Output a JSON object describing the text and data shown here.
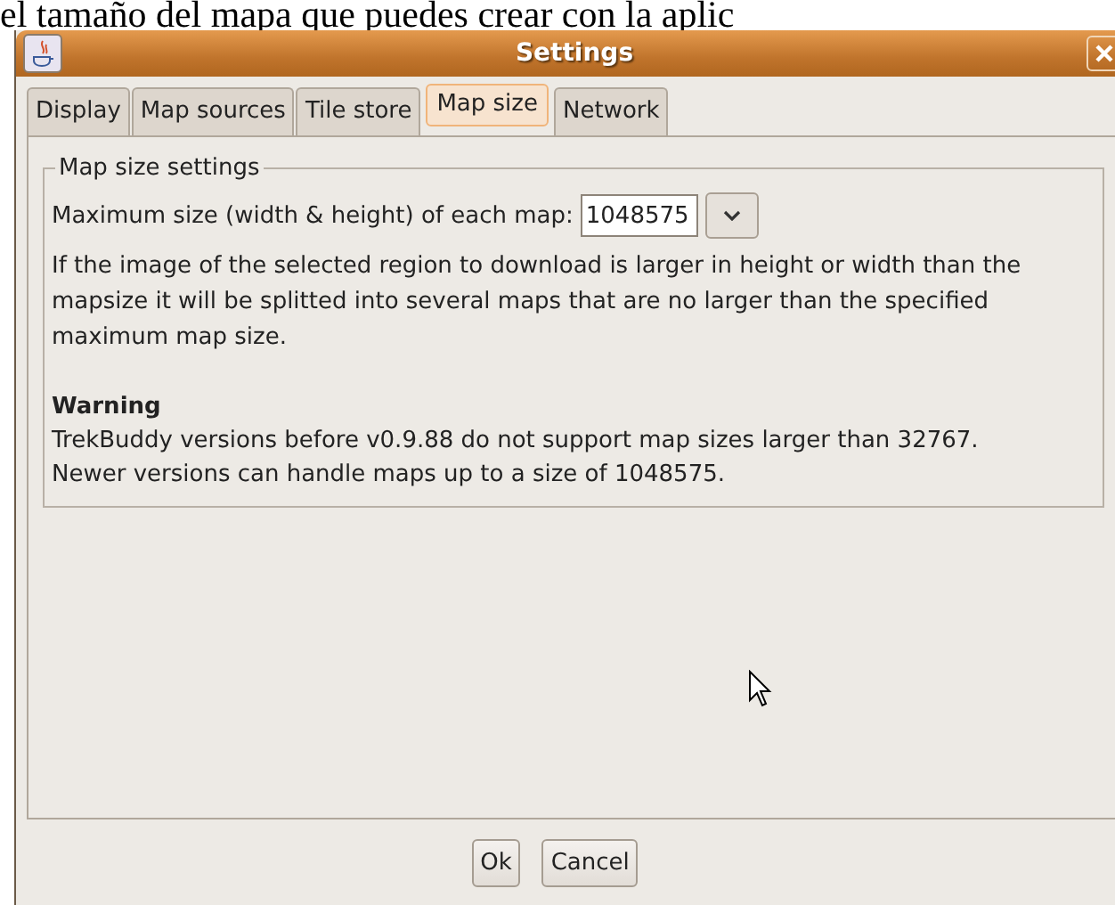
{
  "background_text": "el tamaño del mapa que puedes crear con la aplic",
  "window": {
    "title": "Settings"
  },
  "tabs": [
    {
      "label": "Display",
      "selected": false
    },
    {
      "label": "Map sources",
      "selected": false
    },
    {
      "label": "Tile store",
      "selected": false
    },
    {
      "label": "Map size",
      "selected": true
    },
    {
      "label": "Network",
      "selected": false
    }
  ],
  "group": {
    "title": "Map size settings",
    "field_label": "Maximum size (width & height) of each map:",
    "field_value": "1048575",
    "description": "If the image of the selected region to download is larger in height or width than the mapsize it will be splitted into several maps that are no larger than the specified maximum map size.",
    "warning_title": "Warning",
    "warning_lines": [
      "TrekBuddy versions before v0.9.88 do not support map sizes larger than 32767.",
      "Newer versions can handle maps up to a size of 1048575."
    ]
  },
  "buttons": [
    "Ok",
    "Cancel"
  ]
}
